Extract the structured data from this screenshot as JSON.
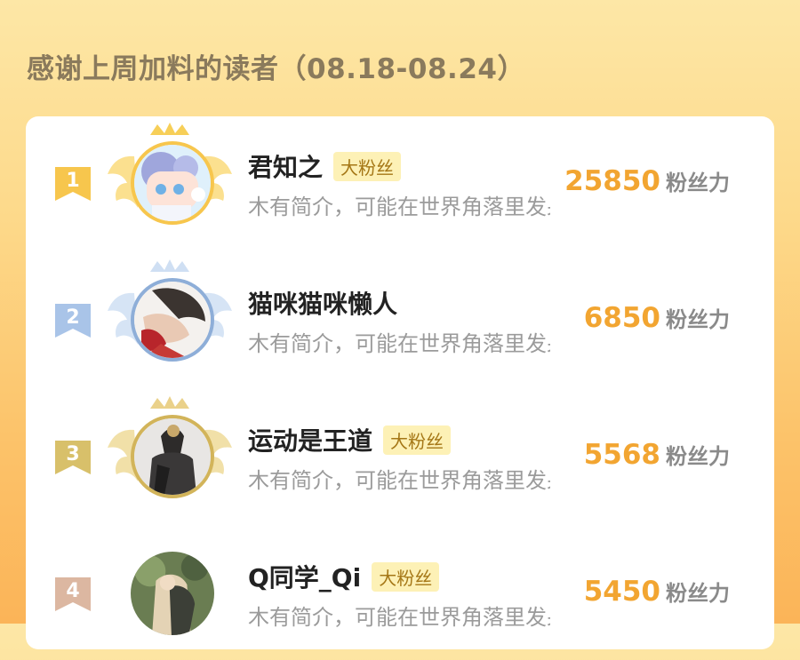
{
  "page": {
    "title": "感谢上周加料的读者（08.18-08.24）"
  },
  "colors": {
    "gold": "#f7c64d",
    "silver": "#a9c4e8",
    "bronze": "#d8c06a",
    "fourth": "#dcb7a1",
    "score": "#f2a531",
    "badge_bg": "#fdf1b6"
  },
  "readers": [
    {
      "rank": "1",
      "name": "君知之",
      "badge": "大粉丝",
      "intro": "木有简介，可能在世界角落里发呆吧~",
      "score": "25850",
      "unit": "粉丝力"
    },
    {
      "rank": "2",
      "name": "猫咪猫咪懒人",
      "badge": "",
      "intro": "木有简介，可能在世界角落里发呆吧~",
      "score": "6850",
      "unit": "粉丝力"
    },
    {
      "rank": "3",
      "name": "运动是王道",
      "badge": "大粉丝",
      "intro": "木有简介，可能在世界角落里发呆吧~",
      "score": "5568",
      "unit": "粉丝力"
    },
    {
      "rank": "4",
      "name": "Q同学_Qi",
      "badge": "大粉丝",
      "intro": "木有简介，可能在世界角落里发呆吧~",
      "score": "5450",
      "unit": "粉丝力"
    }
  ]
}
